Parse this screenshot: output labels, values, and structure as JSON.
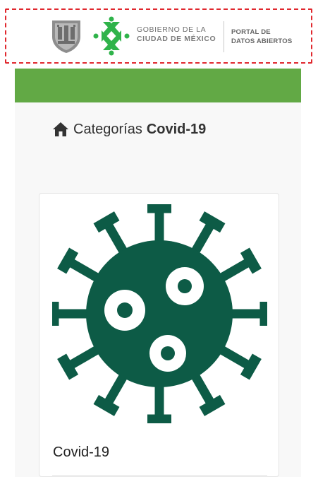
{
  "header": {
    "government_line1": "GOBIERNO DE LA",
    "government_line2": "CIUDAD DE MÉXICO",
    "portal_line1": "PORTAL DE",
    "portal_line2": "DATOS ABIERTOS"
  },
  "colors": {
    "brand_green": "#62a945",
    "virus_green": "#0d5b46",
    "logo_green": "#2fb34a",
    "highlight_red": "#e0282e"
  },
  "icons": {
    "home": "home-icon",
    "shield": "shield-logo",
    "cdmx": "cdmx-logo",
    "virus": "virus-icon"
  },
  "breadcrumb": {
    "category_label": "Categorías",
    "current_label": "Covid-19"
  },
  "card": {
    "title": "Covid-19"
  }
}
